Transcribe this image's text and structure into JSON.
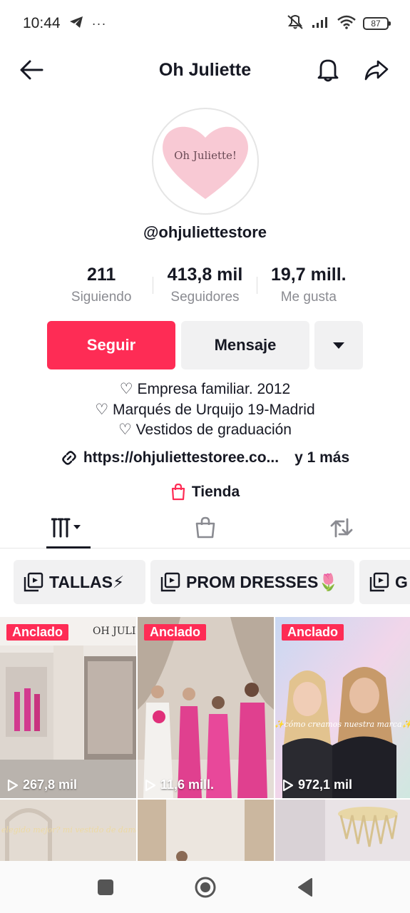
{
  "status": {
    "time": "10:44",
    "battery": "87"
  },
  "header": {
    "title": "Oh Juliette"
  },
  "profile": {
    "avatar_text": "Oh Juliette!",
    "handle": "@ohjuliettestore",
    "stats": [
      {
        "value": "211",
        "label": "Siguiendo"
      },
      {
        "value": "413,8 mil",
        "label": "Seguidores"
      },
      {
        "value": "19,7 mill.",
        "label": "Me gusta"
      }
    ],
    "follow_label": "Seguir",
    "message_label": "Mensaje",
    "bio": [
      "♡ Empresa familiar. 2012",
      "♡ Marqués de Urquijo 19-Madrid",
      "♡ Vestidos de graduación"
    ],
    "link": "https://ohjuliettestoree.co...",
    "link_more": "y 1 más",
    "shop_label": "Tienda"
  },
  "playlists": [
    {
      "label": "TALLAS⚡"
    },
    {
      "label": "PROM DRESSES🌷"
    },
    {
      "label": "G"
    }
  ],
  "videos": [
    {
      "pinned_label": "Anclado",
      "views": "267,8 mil",
      "sign_text": "OH JULIET"
    },
    {
      "pinned_label": "Anclado",
      "views": "11,6 mill."
    },
    {
      "pinned_label": "Anclado",
      "views": "972,1 mil",
      "overlay_text": "✨cómo creamos nuestra marca✨"
    },
    {
      "overlay_text": "¿Quién ha elegido mejor? mi vestido de dama de honor"
    },
    {},
    {}
  ],
  "colors": {
    "accent": "#fe2c55",
    "button_grey": "#f1f1f2",
    "text": "#161823",
    "muted": "#8a8b91"
  }
}
